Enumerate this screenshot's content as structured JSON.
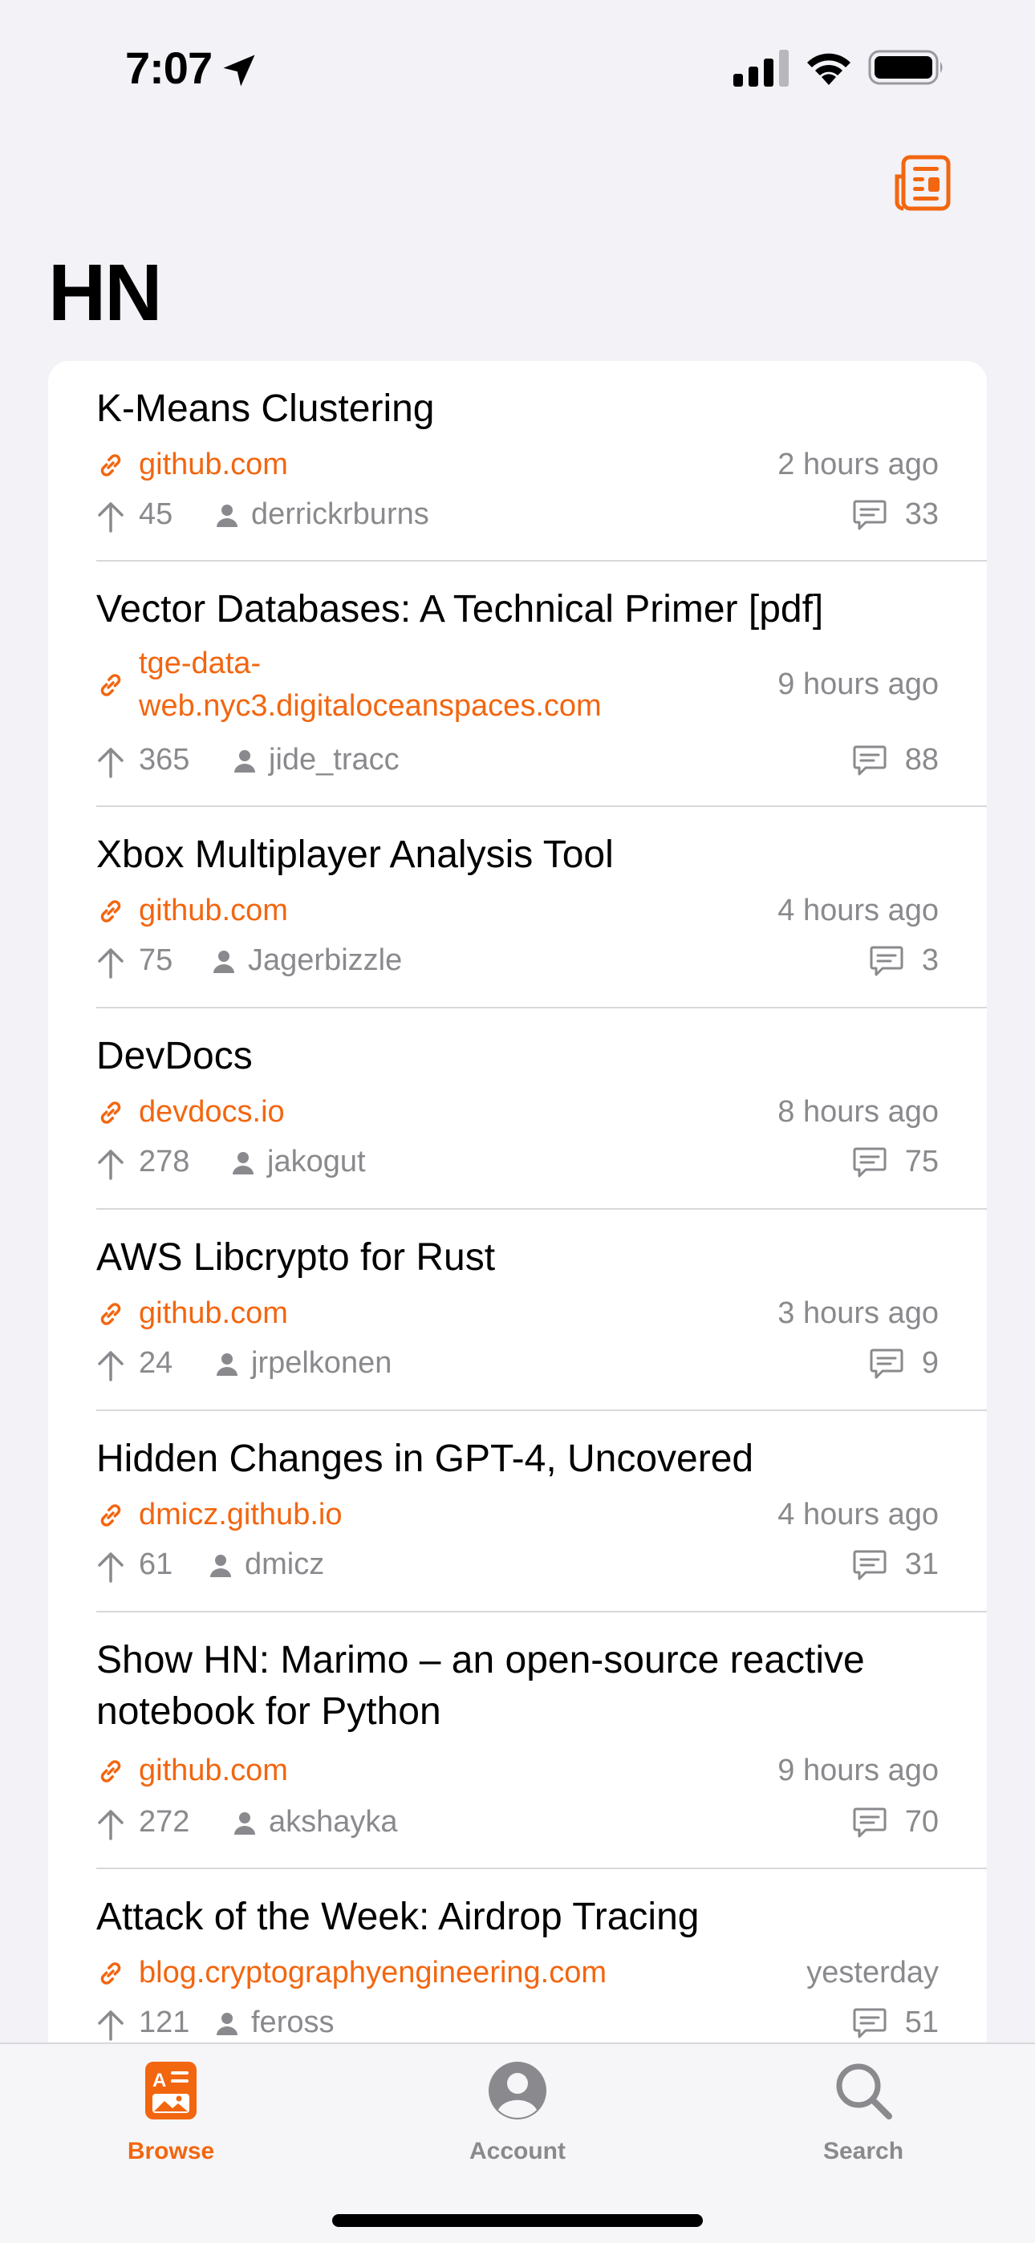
{
  "status_bar": {
    "time": "7:07"
  },
  "nav": {
    "title": "HN"
  },
  "stories": [
    {
      "title": "K-Means Clustering",
      "domain": "github.com",
      "time": "2 hours ago",
      "points": "45",
      "author": "derrickrburns",
      "comments": "33"
    },
    {
      "title": "Vector Databases: A Technical Primer [pdf]",
      "domain_line1": "tge-data-",
      "domain_line2": "web.nyc3.digitaloceanspaces.com",
      "time": "9 hours ago",
      "points": "365",
      "author": "jide_tracc",
      "comments": "88"
    },
    {
      "title": "Xbox Multiplayer Analysis Tool",
      "domain": "github.com",
      "time": "4 hours ago",
      "points": "75",
      "author": "Jagerbizzle",
      "comments": "3"
    },
    {
      "title": "DevDocs",
      "domain": "devdocs.io",
      "time": "8 hours ago",
      "points": "278",
      "author": "jakogut",
      "comments": "75"
    },
    {
      "title": "AWS Libcrypto for Rust",
      "domain": "github.com",
      "time": "3 hours ago",
      "points": "24",
      "author": "jrpelkonen",
      "comments": "9"
    },
    {
      "title": "Hidden Changes in GPT-4, Uncovered",
      "domain": "dmicz.github.io",
      "time": "4 hours ago",
      "points": "61",
      "author": "dmicz",
      "comments": "31"
    },
    {
      "title_line1": "Show HN: Marimo – an open-source reactive",
      "title_line2": "notebook for Python",
      "domain": "github.com",
      "time": "9 hours ago",
      "points": "272",
      "author": "akshayka",
      "comments": "70"
    },
    {
      "title": "Attack of the Week: Airdrop Tracing",
      "domain": "blog.cryptographyengineering.com",
      "time": "yesterday",
      "points": "121",
      "author": "feross",
      "comments": "51"
    }
  ],
  "tab_bar": {
    "tabs": [
      {
        "label": "Browse",
        "icon": "browse-icon",
        "active": true
      },
      {
        "label": "Account",
        "icon": "account-icon",
        "active": false
      },
      {
        "label": "Search",
        "icon": "search-icon",
        "active": false
      }
    ]
  },
  "colors": {
    "accent": "#f26610",
    "secondary": "#8a8a8e",
    "background": "#f2f2f7"
  }
}
